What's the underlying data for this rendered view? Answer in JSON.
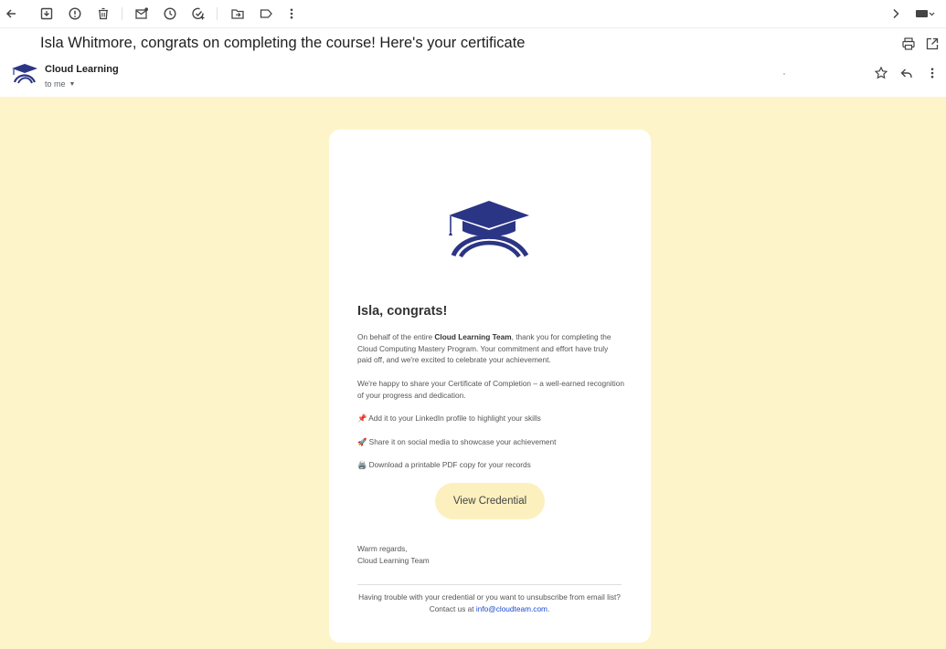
{
  "toolbar": {
    "icons": [
      "back-icon",
      "archive-icon",
      "report-spam-icon",
      "delete-icon",
      "mark-unread-icon",
      "snooze-icon",
      "add-to-tasks-icon",
      "move-to-icon",
      "label-icon",
      "more-icon",
      "next-icon",
      "keyboard-icon"
    ]
  },
  "email": {
    "subject": "Isla Whitmore, congrats on completing the course! Here's your certificate",
    "sender": "Cloud Learning",
    "recipient_label": "to me"
  },
  "message": {
    "greeting": "Isla, congrats!",
    "p1_before": "On behalf of the entire ",
    "p1_bold": "Cloud Learning Team",
    "p1_after": ", thank you for completing the Cloud Computing Mastery Program. Your commitment and effort have truly paid off, and we're excited to celebrate your achievement.",
    "p2": "We're happy to share your Certificate of Completion – a well-earned recognition of your progress and dedication.",
    "bullet1_icon": "📌",
    "bullet1": "Add it to your LinkedIn profile to highlight your skills",
    "bullet2_icon": "🚀",
    "bullet2": "Share it on social media to showcase your achievement",
    "bullet3_icon": "🖨️",
    "bullet3": "Download a printable PDF copy for your records",
    "cta_label": "View Credential",
    "signoff_line1": "Warm regards,",
    "signoff_line2": "Cloud Learning Team",
    "footer_text": "Having trouble with your credential or you want to unsubscribe from email list? Contact us at ",
    "footer_email": "info@cloudteam.com",
    "footer_end": "."
  },
  "colors": {
    "background": "#fdf5c9",
    "brand_navy": "#2b3585",
    "button_bg": "#fcf0bf",
    "link": "#1a4bd0"
  }
}
